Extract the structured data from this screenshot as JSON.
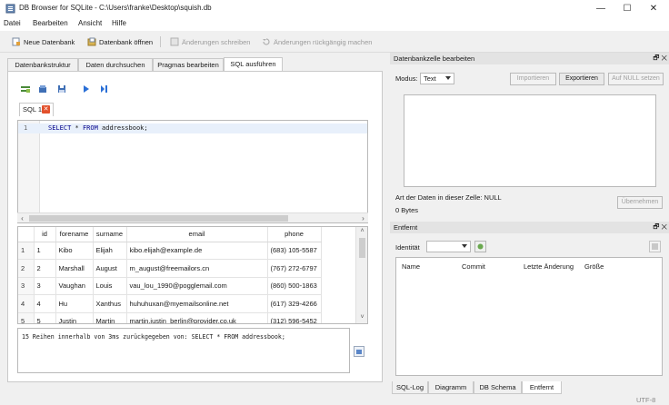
{
  "window": {
    "title": "DB Browser for SQLite - C:\\Users\\franke\\Desktop\\squish.db",
    "minimize": "—",
    "maximize": "☐",
    "close": "✕"
  },
  "menu": [
    "Datei",
    "Bearbeiten",
    "Ansicht",
    "Hilfe"
  ],
  "toolbar": {
    "new_db": "Neue Datenbank",
    "open_db": "Datenbank öffnen",
    "write_changes": "Änderungen schreiben",
    "revert_changes": "Änderungen rückgängig machen"
  },
  "main_tabs": [
    "Datenbankstruktur",
    "Daten durchsuchen",
    "Pragmas bearbeiten",
    "SQL ausführen"
  ],
  "sql_tab": {
    "label": "SQL 1",
    "close": "✕"
  },
  "editor": {
    "line_number": "1",
    "keyword1": "SELECT",
    "star": " * ",
    "keyword2": "FROM",
    "table": " addressbook;"
  },
  "results": {
    "columns": [
      "id",
      "forename",
      "surname",
      "email",
      "phone"
    ],
    "rows": [
      [
        "1",
        "1",
        "Kibo",
        "Elijah",
        "kibo.elijah@example.de",
        "(683) 105-5587"
      ],
      [
        "2",
        "2",
        "Marshall",
        "August",
        "m_august@freemailors.cn",
        "(767) 272-6797"
      ],
      [
        "3",
        "3",
        "Vaughan",
        "Louis",
        "vau_lou_1990@pogglemail.com",
        "(860) 500-1863"
      ],
      [
        "4",
        "4",
        "Hu",
        "Xanthus",
        "huhuhuxan@myemailsonline.net",
        "(617) 329-4266"
      ],
      [
        "5",
        "5",
        "Justin",
        "Martin",
        "martin.justin_berlin@provider.co.uk",
        "(312) 596-5452"
      ]
    ]
  },
  "message": "15 Reihen innerhalb von 3ms zurückgegeben von: SELECT * FROM addressbook;",
  "cell_editor": {
    "title": "Datenbankzelle bearbeiten",
    "float_close": "🗗 ✕",
    "mode_label": "Modus:",
    "mode_value": "Text",
    "import": "Importieren",
    "export": "Exportieren",
    "set_null": "Auf NULL setzen",
    "data_type": "Art der Daten in dieser Zelle: NULL",
    "size": "0 Bytes",
    "apply": "Übernehmen"
  },
  "remote": {
    "title": "Entfernt",
    "float_close": "🗗 ✕",
    "identity_label": "Identität",
    "columns": [
      "Name",
      "Commit",
      "Letzte Änderung",
      "Größe"
    ]
  },
  "bottom_tabs": [
    "SQL-Log",
    "Diagramm",
    "DB Schema",
    "Entfernt"
  ],
  "status": {
    "encoding": "UTF-8"
  },
  "colors": {
    "accent": "#1a5fb4",
    "close_tab": "#e2502b",
    "keyword": "#00008b"
  }
}
